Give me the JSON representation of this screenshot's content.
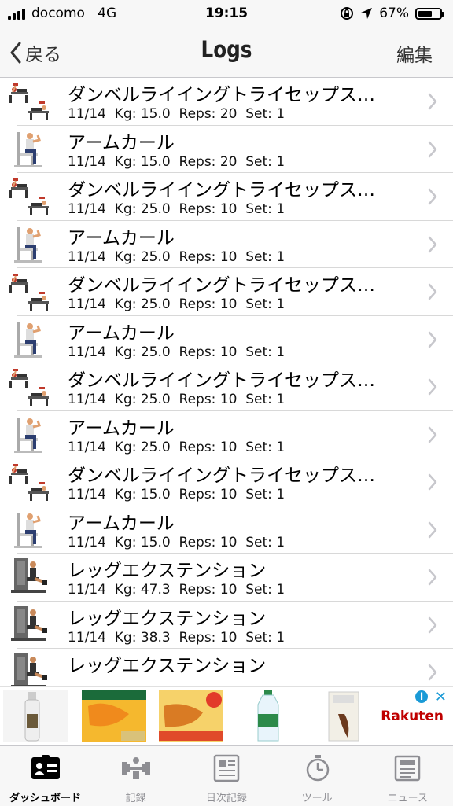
{
  "status_bar": {
    "carrier": "docomo",
    "network": "4G",
    "time": "19:15",
    "battery": "67%",
    "battery_level": 0.67
  },
  "nav": {
    "back_label": "戻る",
    "title": "Logs",
    "edit_label": "編集"
  },
  "logs": [
    {
      "name": "ダンベルライイングトライセップス…",
      "detail": "11/14  Kg: 15.0  Reps: 20  Set: 1",
      "icon": "lying-triceps-icon"
    },
    {
      "name": "アームカール",
      "detail": "11/14  Kg: 15.0  Reps: 20  Set: 1",
      "icon": "arm-curl-icon"
    },
    {
      "name": "ダンベルライイングトライセップス…",
      "detail": "11/14  Kg: 25.0  Reps: 10  Set: 1",
      "icon": "lying-triceps-icon"
    },
    {
      "name": "アームカール",
      "detail": "11/14  Kg: 25.0  Reps: 10  Set: 1",
      "icon": "arm-curl-icon"
    },
    {
      "name": "ダンベルライイングトライセップス…",
      "detail": "11/14  Kg: 25.0  Reps: 10  Set: 1",
      "icon": "lying-triceps-icon"
    },
    {
      "name": "アームカール",
      "detail": "11/14  Kg: 25.0  Reps: 10  Set: 1",
      "icon": "arm-curl-icon"
    },
    {
      "name": "ダンベルライイングトライセップス…",
      "detail": "11/14  Kg: 25.0  Reps: 10  Set: 1",
      "icon": "lying-triceps-icon"
    },
    {
      "name": "アームカール",
      "detail": "11/14  Kg: 25.0  Reps: 10  Set: 1",
      "icon": "arm-curl-icon"
    },
    {
      "name": "ダンベルライイングトライセップス…",
      "detail": "11/14  Kg: 15.0  Reps: 10  Set: 1",
      "icon": "lying-triceps-icon"
    },
    {
      "name": "アームカール",
      "detail": "11/14  Kg: 15.0  Reps: 10  Set: 1",
      "icon": "arm-curl-icon"
    },
    {
      "name": "レッグエクステンション",
      "detail": "11/14  Kg: 47.3  Reps: 10  Set: 1",
      "icon": "leg-extension-icon"
    },
    {
      "name": "レッグエクステンション",
      "detail": "11/14  Kg: 38.3  Reps: 10  Set: 1",
      "icon": "leg-extension-icon"
    },
    {
      "name": "レッグエクステンション",
      "detail": "",
      "icon": "leg-extension-icon"
    }
  ],
  "ad": {
    "brand": "Rakuten",
    "products": [
      "bottle-product-icon",
      "dried-mango-product-icon",
      "dried-pineapple-product-icon",
      "water-bottle-product-icon",
      "snack-bag-product-icon"
    ]
  },
  "tabs": [
    {
      "label": "ダッシュボード",
      "icon": "dashboard-icon",
      "active": true
    },
    {
      "label": "記録",
      "icon": "dumbbell-icon",
      "active": false
    },
    {
      "label": "日次記録",
      "icon": "daily-log-icon",
      "active": false
    },
    {
      "label": "ツール",
      "icon": "stopwatch-icon",
      "active": false
    },
    {
      "label": "ニュース",
      "icon": "news-icon",
      "active": false
    }
  ],
  "colors": {
    "bar_bg": "#f7f7f7",
    "ad_brand": "#bf0000",
    "ad_info": "#1a9ad6",
    "tab_active": "#000000",
    "tab_inactive": "#8e8e93"
  }
}
